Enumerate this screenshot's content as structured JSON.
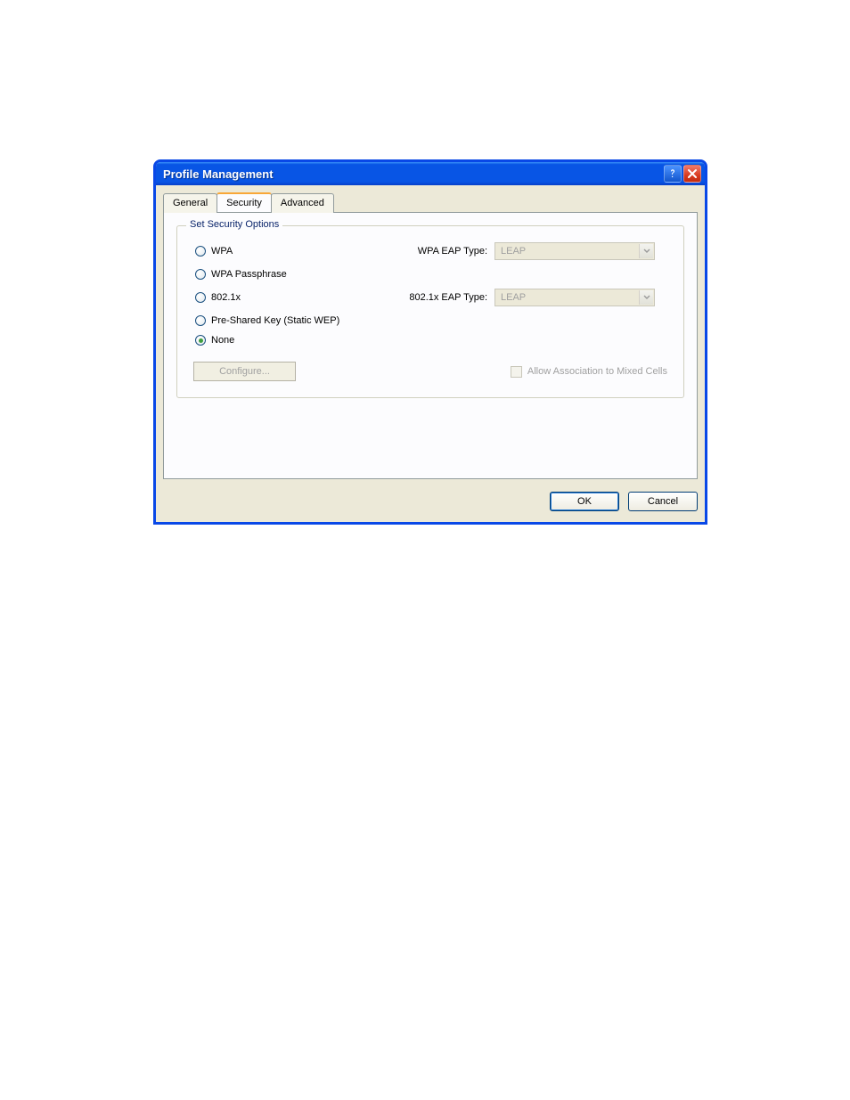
{
  "window": {
    "title": "Profile Management"
  },
  "tabs": {
    "general": "General",
    "security": "Security",
    "advanced": "Advanced"
  },
  "fieldset": {
    "legend": "Set Security Options"
  },
  "radios": {
    "wpa": "WPA",
    "wpa_passphrase": "WPA Passphrase",
    "dot1x": "802.1x",
    "psk": "Pre-Shared Key (Static WEP)",
    "none": "None"
  },
  "eap": {
    "wpa_label": "WPA EAP Type:",
    "wpa_value": "LEAP",
    "dot1x_label": "802.1x EAP Type:",
    "dot1x_value": "LEAP"
  },
  "configure_btn": "Configure...",
  "allow_mixed": "Allow Association to Mixed Cells",
  "buttons": {
    "ok": "OK",
    "cancel": "Cancel"
  }
}
